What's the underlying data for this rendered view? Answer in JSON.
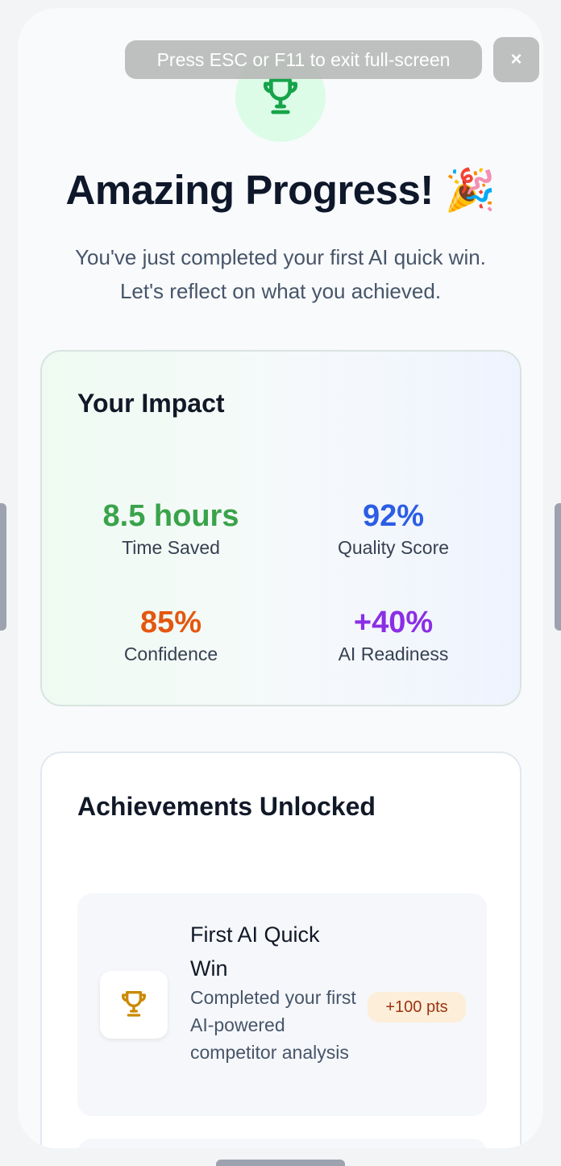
{
  "fullscreen": {
    "message": "Press ESC or F11 to exit full-screen",
    "close_label": "×"
  },
  "header": {
    "icon": "trophy-icon",
    "title": "Amazing Progress! 🎉",
    "subtitle_line1": "You've just completed your first AI quick win.",
    "subtitle_line2": "Let's reflect on what you achieved."
  },
  "impact": {
    "heading": "Your Impact",
    "metrics": [
      {
        "value": "8.5 hours",
        "label": "Time Saved",
        "color": "#3aa34a"
      },
      {
        "value": "92%",
        "label": "Quality Score",
        "color": "#2c5de5"
      },
      {
        "value": "85%",
        "label": "Confidence",
        "color": "#e4570f"
      },
      {
        "value": "+40%",
        "label": "AI Readiness",
        "color": "#8b2ee6"
      }
    ]
  },
  "achievements": {
    "heading": "Achievements Unlocked",
    "items": [
      {
        "icon": "trophy-icon",
        "title": "First AI Quick Win",
        "description": "Completed your first AI-powered competitor analysis",
        "points": "+100 pts"
      }
    ]
  },
  "colors": {
    "accent_green": "#16a34a",
    "trophy_gold": "#ca8a04",
    "background": "#f8fafc"
  }
}
